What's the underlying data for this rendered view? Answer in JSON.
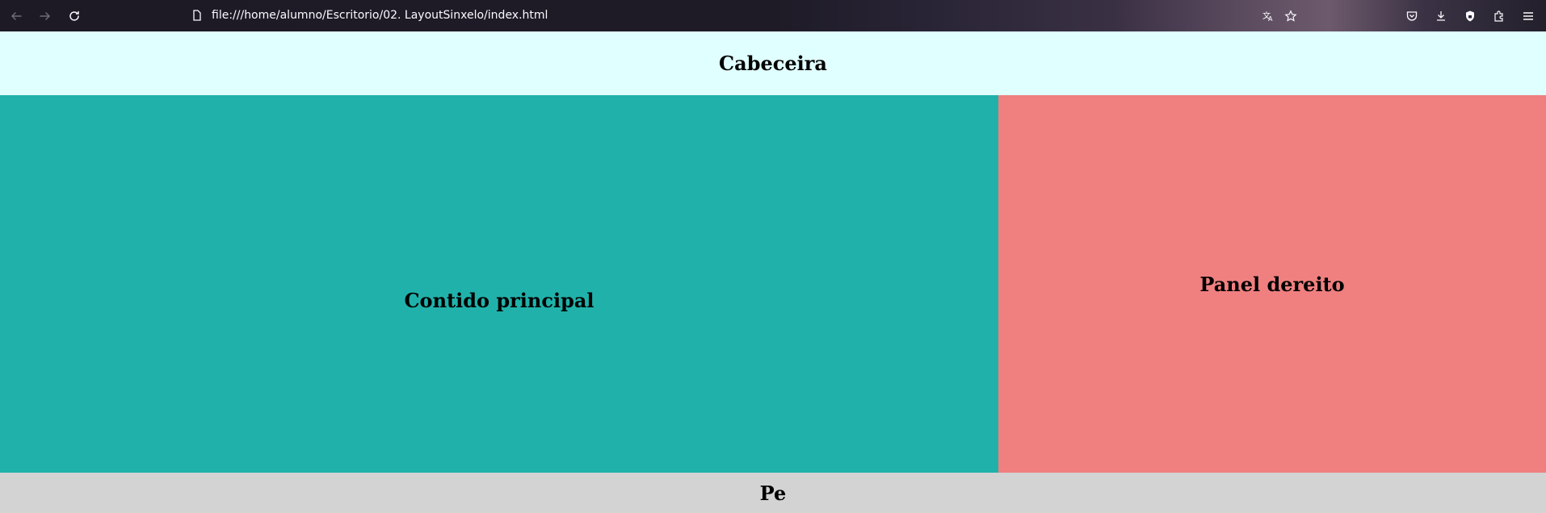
{
  "browser": {
    "url": "file:///home/alumno/Escritorio/02. LayoutSinxelo/index.html",
    "icons": {
      "back": "back-arrow-icon",
      "forward": "forward-arrow-icon",
      "reload": "reload-icon",
      "page": "page-document-icon",
      "translate": "translate-icon",
      "bookmark": "bookmark-star-icon",
      "pocket": "pocket-icon",
      "downloads": "downloads-icon",
      "lock": "lockwise-icon",
      "extensions": "extensions-icon",
      "menu": "hamburger-menu-icon"
    }
  },
  "page": {
    "header_title": "Cabeceira",
    "main_title": "Contido principal",
    "aside_title": "Panel dereito",
    "footer_title": "Pe",
    "colors": {
      "header": "#e0ffff",
      "main": "#20b2aa",
      "aside": "#f08080",
      "footer": "#d3d3d3"
    }
  }
}
